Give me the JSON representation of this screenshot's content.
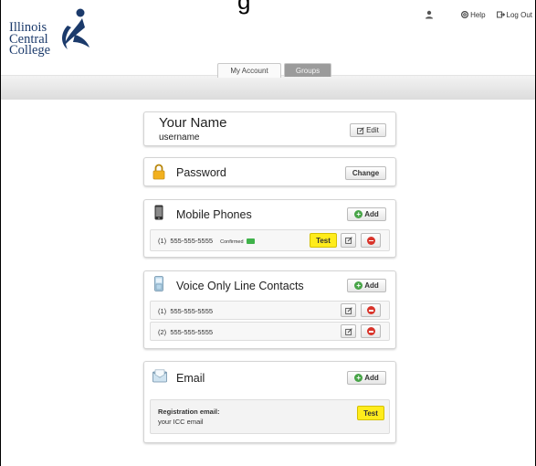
{
  "header": {
    "title_fragment": "g",
    "logo_lines": [
      "Illinois",
      "Central",
      "College"
    ],
    "help_label": "Help",
    "logout_label": "Log Out"
  },
  "tabs": [
    {
      "label": "My Account",
      "active": true
    },
    {
      "label": "Groups",
      "active": false
    }
  ],
  "profile": {
    "name": "Your Name",
    "username": "username",
    "edit_label": "Edit"
  },
  "password": {
    "label": "Password",
    "change_label": "Change"
  },
  "mobile": {
    "label": "Mobile Phones",
    "add_label": "Add",
    "entries": [
      {
        "index": "(1)",
        "number": "555-555-5555",
        "status": "Confirmed",
        "test_label": "Test"
      }
    ]
  },
  "voice": {
    "label": "Voice Only Line Contacts",
    "add_label": "Add",
    "entries": [
      {
        "index": "(1)",
        "number": "555-555-5555"
      },
      {
        "index": "(2)",
        "number": "555-555-5555"
      }
    ]
  },
  "email": {
    "label": "Email",
    "add_label": "Add",
    "reg_label": "Registration email:",
    "reg_value": "your ICC email",
    "test_label": "Test"
  },
  "colors": {
    "accent_yellow": "#ffec1c",
    "add_green": "#47a447",
    "delete_red": "#d9342b",
    "logo_blue": "#1b3a6b"
  }
}
